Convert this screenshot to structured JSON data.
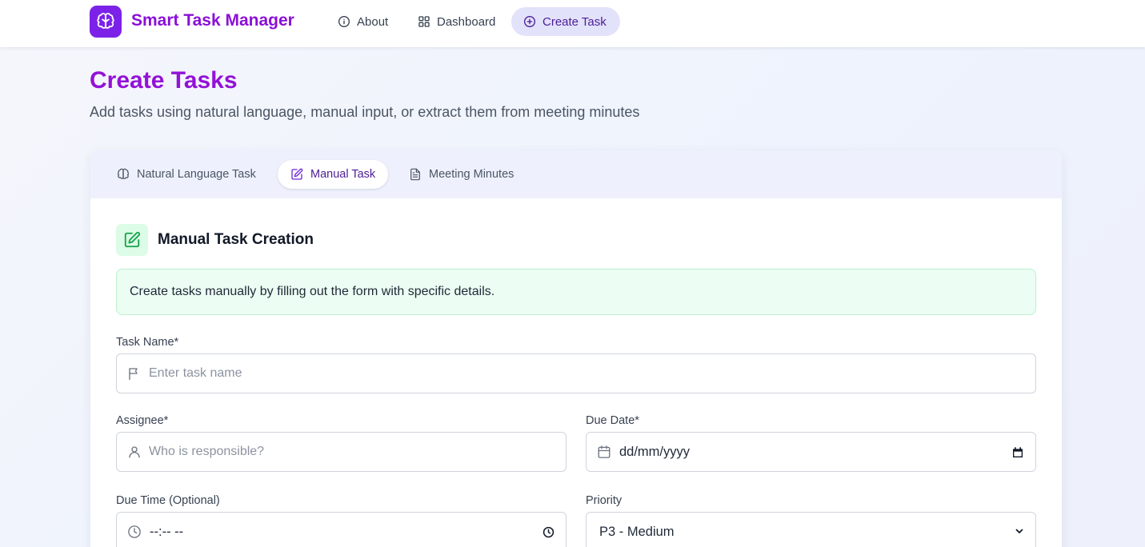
{
  "header": {
    "app_title": "Smart Task Manager",
    "nav": [
      {
        "label": "About",
        "icon": "info-icon"
      },
      {
        "label": "Dashboard",
        "icon": "grid-icon"
      },
      {
        "label": "Create Task",
        "icon": "plus-circle-icon",
        "active": true
      }
    ]
  },
  "page": {
    "title": "Create Tasks",
    "subtitle": "Add tasks using natural language, manual input, or extract them from meeting minutes"
  },
  "tabs": [
    {
      "label": "Natural Language Task",
      "icon": "brain-icon"
    },
    {
      "label": "Manual Task",
      "icon": "edit-icon",
      "active": true
    },
    {
      "label": "Meeting Minutes",
      "icon": "document-icon"
    }
  ],
  "section": {
    "title": "Manual Task Creation",
    "info": "Create tasks manually by filling out the form with specific details."
  },
  "form": {
    "task_name": {
      "label": "Task Name*",
      "placeholder": "Enter task name"
    },
    "assignee": {
      "label": "Assignee*",
      "placeholder": "Who is responsible?"
    },
    "due_date": {
      "label": "Due Date*",
      "value": "dd/mm/yyyy"
    },
    "due_time": {
      "label": "Due Time (Optional)",
      "value": "--:-- --"
    },
    "priority": {
      "label": "Priority",
      "value": "P3 - Medium"
    }
  },
  "colors": {
    "brand_purple": "#9312d6",
    "logo_bg": "#7c22e8",
    "active_nav_bg": "#e2e2fb",
    "info_bg": "#ecfdf3",
    "section_icon_green": "#16a34a"
  }
}
